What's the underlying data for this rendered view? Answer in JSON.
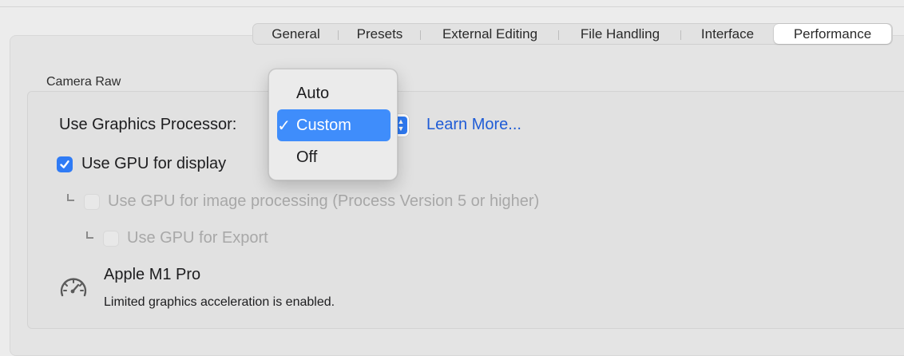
{
  "tabs": [
    {
      "label": "General",
      "active": false
    },
    {
      "label": "Presets",
      "active": false
    },
    {
      "label": "External Editing",
      "active": false
    },
    {
      "label": "File Handling",
      "active": false
    },
    {
      "label": "Interface",
      "active": false
    },
    {
      "label": "Performance",
      "active": true
    }
  ],
  "camera_raw": {
    "group_label": "Camera Raw",
    "graphics_processor": {
      "label": "Use Graphics Processor:",
      "selected": "Custom",
      "options": [
        "Auto",
        "Custom",
        "Off"
      ],
      "checkmark": "✓"
    },
    "learn_more": "Learn More...",
    "use_gpu_display": {
      "label": "Use GPU for display",
      "checked": true
    },
    "use_gpu_image_processing": {
      "label": "Use GPU for image processing (Process Version 5 or higher)",
      "checked": false,
      "enabled": false
    },
    "use_gpu_export": {
      "label": "Use GPU for Export",
      "checked": false,
      "enabled": false
    },
    "gpu": {
      "name": "Apple M1 Pro",
      "status": "Limited graphics acceleration is enabled.",
      "icon": "gauge-icon"
    }
  },
  "colors": {
    "accent": "#2f7bf5",
    "link": "#1f5cd6",
    "menu_highlight": "#3f8dfb"
  }
}
